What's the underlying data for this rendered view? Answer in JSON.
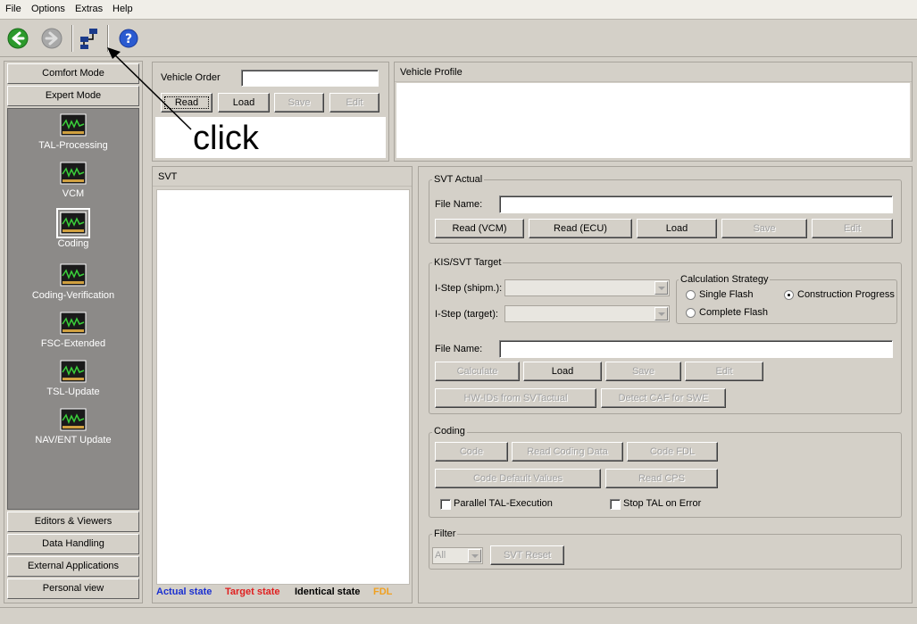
{
  "menu": [
    "File",
    "Options",
    "Extras",
    "Help"
  ],
  "toolbar": {
    "icons": [
      "back-arrow-icon",
      "forward-arrow-icon",
      "network-connect-icon",
      "help-icon"
    ],
    "back_color": "#2c9a2c"
  },
  "sidebar": {
    "top_buttons": [
      "Comfort Mode",
      "Expert Mode"
    ],
    "items": [
      "TAL-Processing",
      "VCM",
      "Coding",
      "Coding-Verification",
      "FSC-Extended",
      "TSL-Update",
      "NAV/ENT Update"
    ],
    "selected": "Coding",
    "bottom_buttons": [
      "Editors & Viewers",
      "Data Handling",
      "External Applications",
      "Personal view"
    ]
  },
  "vehicle_order": {
    "label": "Vehicle Order",
    "value": "",
    "buttons": [
      "Read",
      "Load",
      "Save",
      "Edit"
    ]
  },
  "annotation": "click",
  "vehicle_profile": {
    "title": "Vehicle Profile"
  },
  "svt": {
    "title": "SVT",
    "legend": [
      {
        "text": "Actual state",
        "color": "#1a2fd0"
      },
      {
        "text": "Target state",
        "color": "#e02020"
      },
      {
        "text": "Identical state",
        "color": "#000000"
      },
      {
        "text": "FDL",
        "color": "#f0a020"
      }
    ]
  },
  "svt_actual": {
    "title": "SVT Actual",
    "file_label": "File Name:",
    "file_value": "",
    "buttons": [
      "Read (VCM)",
      "Read (ECU)",
      "Load",
      "Save",
      "Edit"
    ]
  },
  "kis_target": {
    "title": "KIS/SVT Target",
    "istep_shipm_label": "I-Step (shipm.):",
    "istep_target_label": "I-Step (target):",
    "strategy": {
      "title": "Calculation Strategy",
      "options": [
        "Single Flash",
        "Construction Progress",
        "Complete Flash"
      ],
      "selected": "Construction Progress"
    },
    "file_label": "File Name:",
    "file_value": "",
    "buttons": [
      "Calculate",
      "Load",
      "Save",
      "Edit"
    ],
    "buttons2": [
      "HW-IDs from SVTactual",
      "Detect CAF for SWE"
    ]
  },
  "coding": {
    "title": "Coding",
    "buttons": [
      "Code",
      "Read Coding Data",
      "Code FDL"
    ],
    "buttons2": [
      "Code Default Values",
      "Read CPS"
    ],
    "checks": [
      "Parallel TAL-Execution",
      "Stop TAL on Error"
    ]
  },
  "filter": {
    "title": "Filter",
    "value": "All",
    "reset": "SVT Reset"
  }
}
